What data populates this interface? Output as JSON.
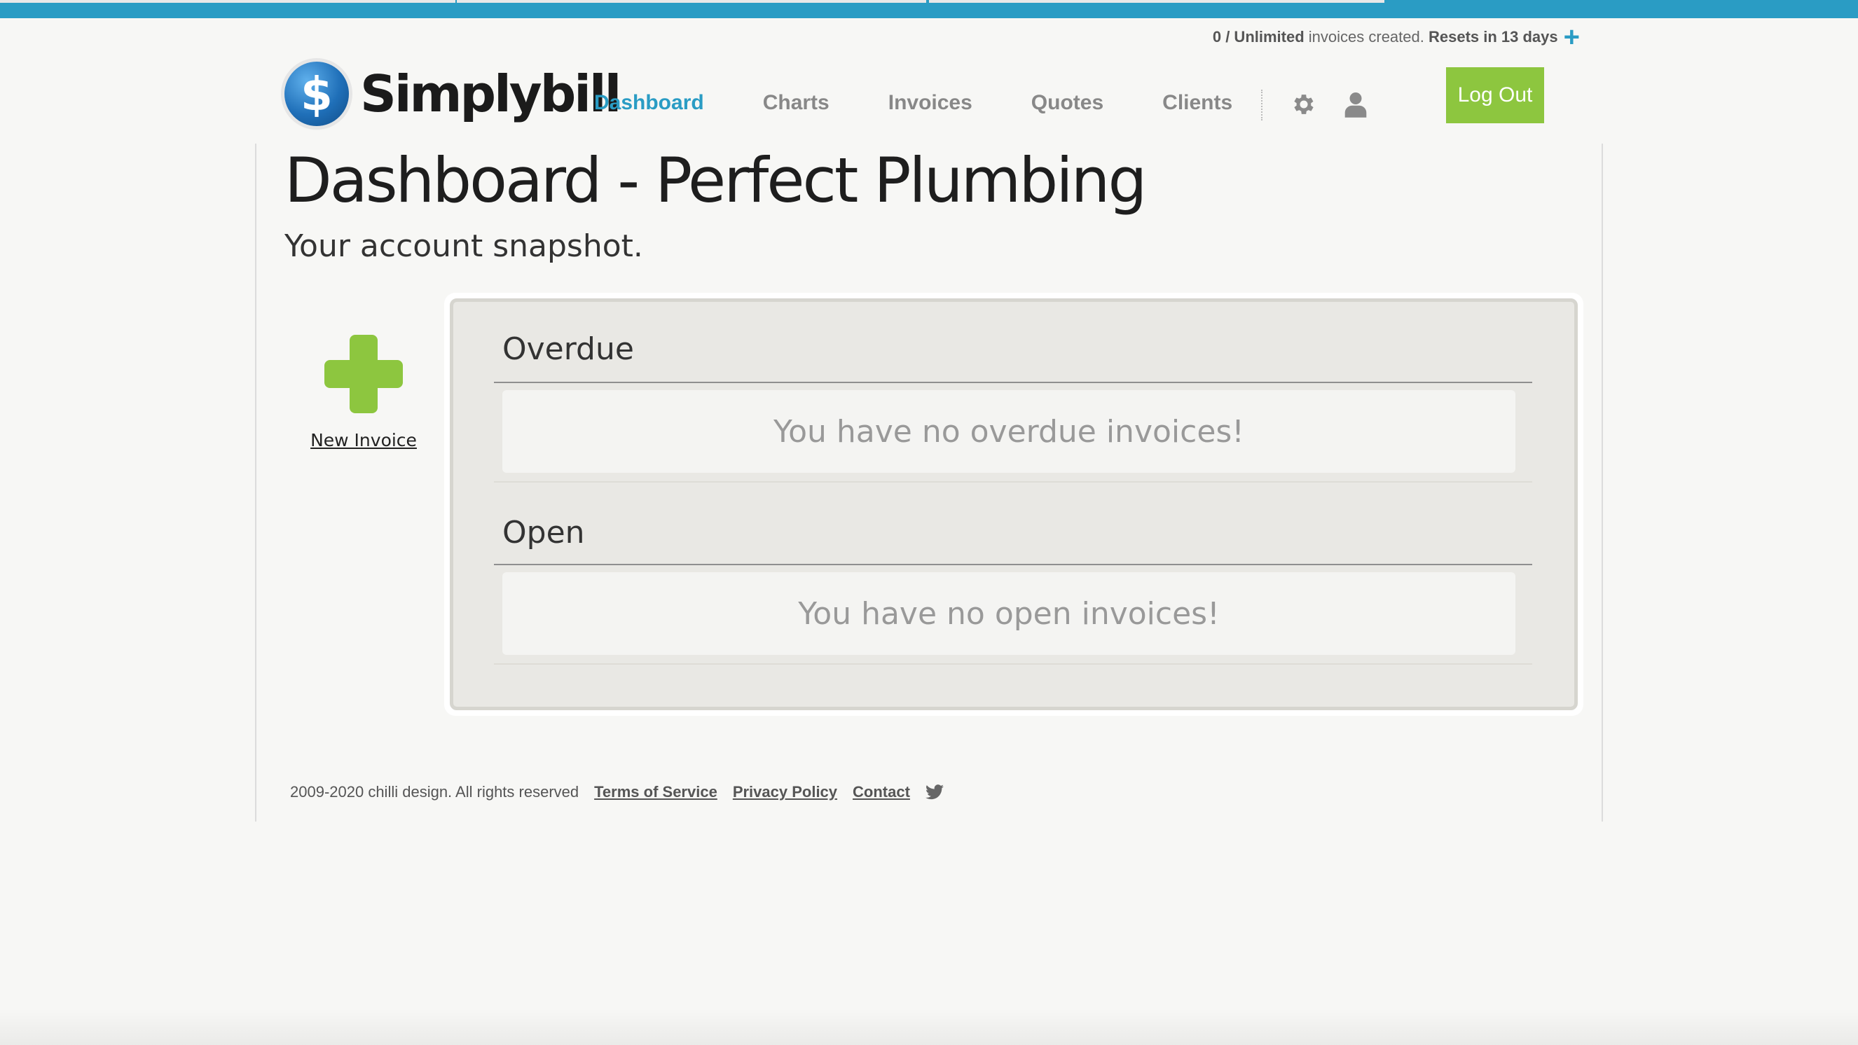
{
  "usage": {
    "count": "0 / Unlimited",
    "middle": " invoices created. ",
    "reset": "Resets in 13 days",
    "plus": "+"
  },
  "brand": {
    "logo_symbol": "$",
    "name": "Simplybill"
  },
  "nav": {
    "items": [
      {
        "label": "Dashboard",
        "active": true
      },
      {
        "label": "Charts",
        "active": false
      },
      {
        "label": "Invoices",
        "active": false
      },
      {
        "label": "Quotes",
        "active": false
      },
      {
        "label": "Clients",
        "active": false
      }
    ],
    "settings_icon": "gear-icon",
    "account_icon": "user-icon",
    "logout_label": "Log Out"
  },
  "page": {
    "title": "Dashboard - Perfect Plumbing",
    "subtitle": "Your account snapshot."
  },
  "new_invoice": {
    "label": "New Invoice",
    "icon": "plus-icon"
  },
  "sections": {
    "overdue": {
      "title": "Overdue",
      "empty_message": "You have no overdue invoices!"
    },
    "open": {
      "title": "Open",
      "empty_message": "You have no open invoices!"
    }
  },
  "footer": {
    "copyright": "2009-2020 chilli design. All rights reserved",
    "links": {
      "terms": "Terms of Service",
      "privacy": "Privacy Policy",
      "contact": "Contact"
    },
    "social_icon": "twitter-icon"
  },
  "colors": {
    "accent_blue": "#2a9cc4",
    "accent_green": "#8dc63f",
    "background": "#f7f7f5",
    "panel": "#e9e8e4"
  }
}
